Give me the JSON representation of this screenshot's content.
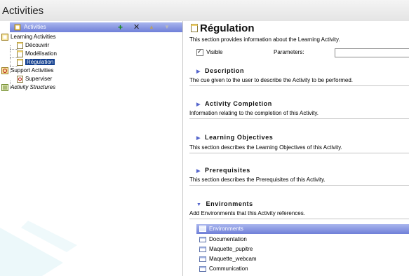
{
  "app": {
    "title": "Activities"
  },
  "tree": {
    "header_label": "Activities",
    "toolbar": {
      "add": "+",
      "delete": "✕",
      "up": "▲",
      "down": "▼"
    },
    "items": [
      {
        "label": "Learning Activities",
        "icon": "activity-folder-icon",
        "level": 0
      },
      {
        "label": "Découvrir",
        "icon": "activity-page-icon",
        "level": 1
      },
      {
        "label": "Modélisation",
        "icon": "activity-page-icon",
        "level": 1
      },
      {
        "label": "Régulation",
        "icon": "activity-page-icon",
        "level": 1,
        "selected": true
      },
      {
        "label": "Support Activities",
        "icon": "support-icon",
        "level": 0
      },
      {
        "label": "Superviser",
        "icon": "support-item-icon",
        "level": 1
      },
      {
        "label": "Activity Structures",
        "icon": "structure-icon",
        "level": 0,
        "italic": true
      }
    ]
  },
  "detail": {
    "title": "Régulation",
    "description": "This section provides information about the Learning Activity.",
    "visible_label": "Visible",
    "visible_checked": true,
    "parameters_label": "Parameters:",
    "parameters_value": "",
    "sections": [
      {
        "title": "Description",
        "text": "The cue given to the user to describe the Activity to be performed.",
        "expanded": false
      },
      {
        "title": "Activity Completion",
        "text": "Information relating to the completion of this Activity.",
        "expanded": false
      },
      {
        "title": "Learning Objectives",
        "text": "This section describes the Learning Objectives of this Activity.",
        "expanded": false
      },
      {
        "title": "Prerequisites",
        "text": "This section describes the Prerequisites of this Activity.",
        "expanded": false
      },
      {
        "title": "Environments",
        "text": "Add Environments that this Activity references.",
        "expanded": true
      }
    ],
    "environments": {
      "header_label": "Environments",
      "items": [
        "Documentation",
        "Maquette_pupitre",
        "Maquette_webcam",
        "Communication"
      ]
    }
  },
  "colors": {
    "header_gradient_top": "#a9b6ee",
    "header_gradient_bottom": "#6f7fd8",
    "selected": "#123f8f",
    "add_green": "#1a8a1a"
  }
}
